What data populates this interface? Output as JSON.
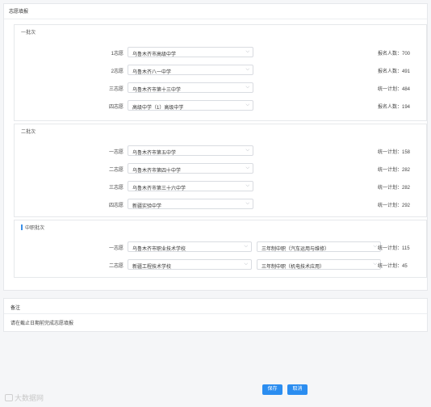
{
  "main_panel": {
    "title": "志愿填报"
  },
  "sections": [
    {
      "title": "一批次",
      "rows": [
        {
          "label": "1志愿",
          "select": "乌鲁木齐市高级中学",
          "rank": "报名人数：700"
        },
        {
          "label": "2志愿",
          "select": "乌鲁木齐八一中学",
          "rank": "报名人数：491"
        },
        {
          "label": "三志愿",
          "select": "乌鲁木齐市第十三中学",
          "rank": "统一计划：484"
        },
        {
          "label": "四志愿",
          "select": "高级中学（1）高级中学",
          "rank": "报名人数：194"
        }
      ]
    },
    {
      "title": "二批次",
      "rows": [
        {
          "label": "一志愿",
          "select": "乌鲁木齐市第五中学",
          "rank": "统一计划：158"
        },
        {
          "label": "二志愿",
          "select": "乌鲁木齐市第四十中学",
          "rank": "统一计划：282"
        },
        {
          "label": "三志愿",
          "select": "乌鲁木齐市第三十六中学",
          "rank": "统一计划：282"
        },
        {
          "label": "四志愿",
          "select": "新疆实验中学",
          "rank": "统一计划：292"
        }
      ]
    },
    {
      "title": "中职批次",
      "rows": [
        {
          "label": "一志愿",
          "select": "乌鲁木齐市职业技术学校",
          "select2": "三年制中职（汽车运用与维修）",
          "rank": "统一计划：115"
        },
        {
          "label": "二志愿",
          "select": "新疆工程技术学校",
          "select2": "三年制中职（机电技术应用）",
          "rank": "统一计划：45"
        }
      ]
    }
  ],
  "remark": {
    "title": "备注",
    "text": "请在截止日期前完成志愿填报"
  },
  "buttons": {
    "save": "保存",
    "cancel": "取消"
  },
  "watermark": "大数据网",
  "icons": {
    "select_chevron": "chevron-down-icon"
  },
  "colors": {
    "primary": "#2b8df0",
    "border": "#d9dce1"
  }
}
